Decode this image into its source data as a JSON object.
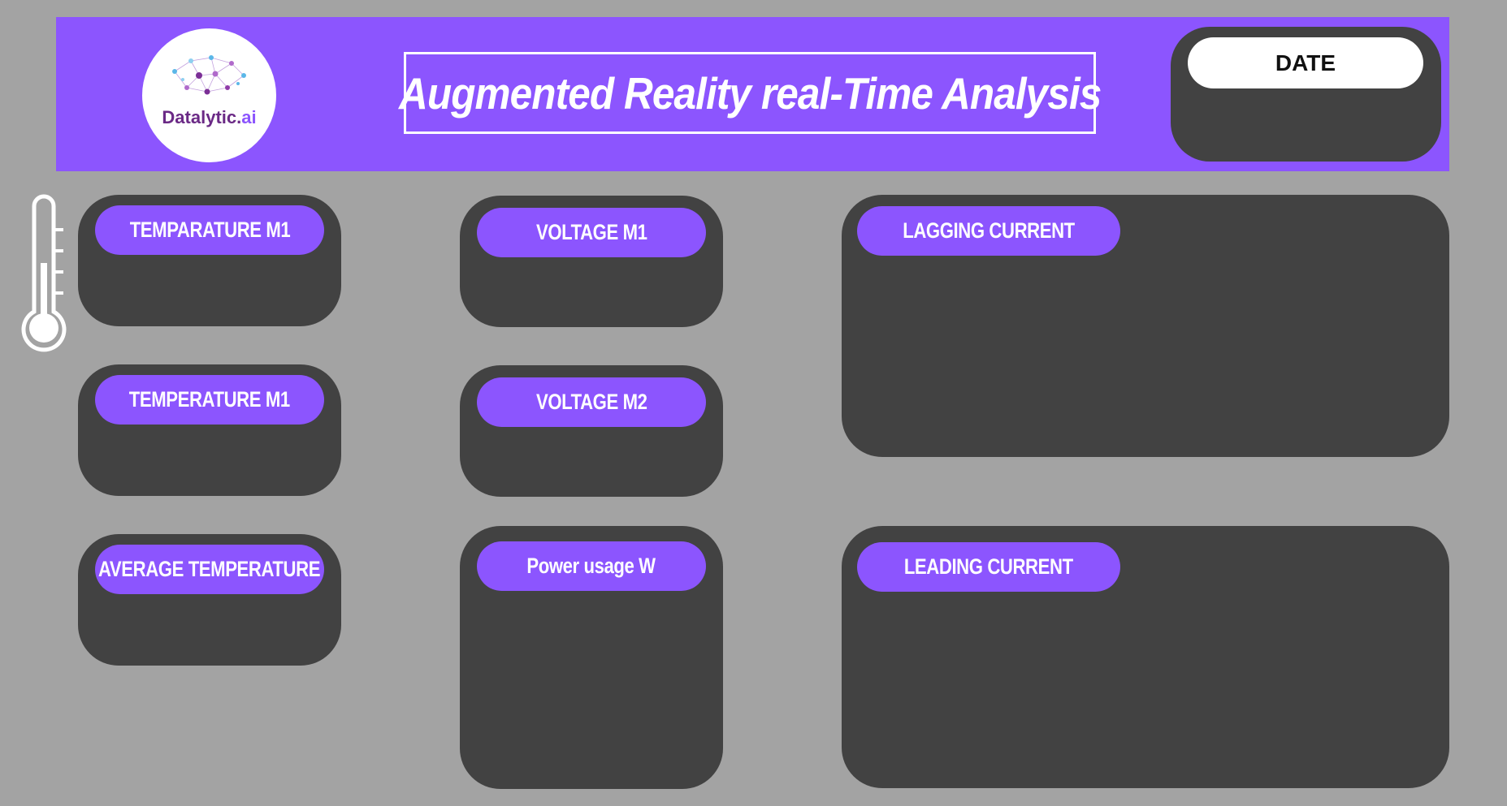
{
  "header": {
    "logo_text_main": "Datalytic.",
    "logo_text_ai": "ai",
    "title": "Augmented Reality real-Time Analysis",
    "date_label": "DATE"
  },
  "cards": {
    "temp_m1_a": "TEMPARATURE M1",
    "temp_m1_b": "TEMPERATURE M1",
    "avg_temp": "AVERAGE TEMPERATURE",
    "voltage_m1": "VOLTAGE M1",
    "voltage_m2": "VOLTAGE M2",
    "power_usage": "Power usage W",
    "lagging_current": "LAGGING CURRENT",
    "leading_current": "LEADING CURRENT"
  },
  "icons": {
    "thermometer": "thermometer-icon",
    "logo": "brain-network-logo"
  },
  "colors": {
    "background": "#a3a3a3",
    "accent": "#8c55fe",
    "card": "#424242",
    "text": "#ffffff"
  }
}
